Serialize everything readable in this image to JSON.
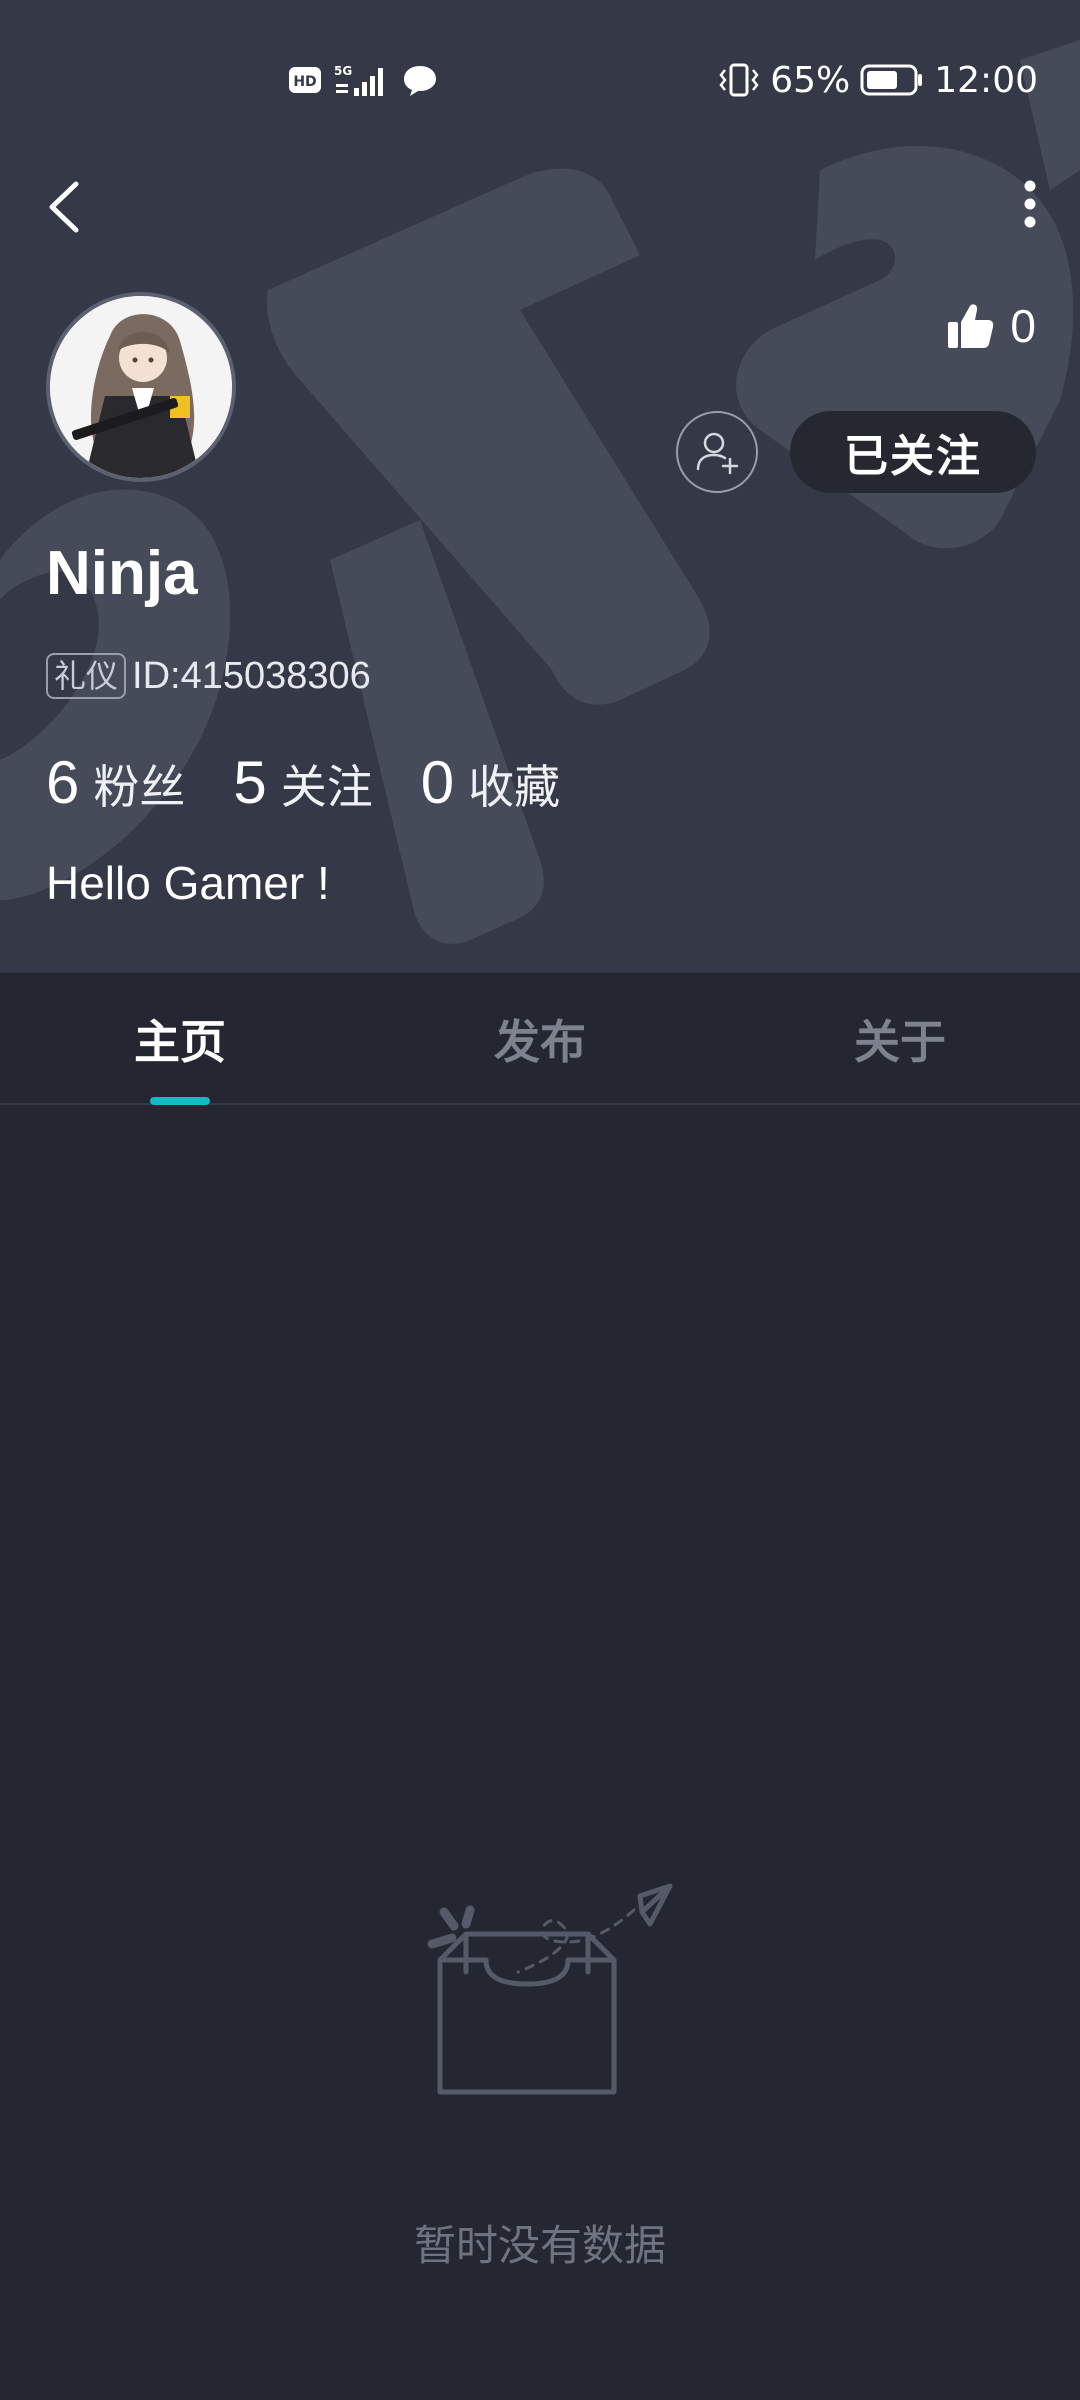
{
  "status_bar": {
    "battery": "65%",
    "time": "12:00",
    "icons": [
      "hd-icon",
      "5g-signal-icon",
      "message-icon",
      "vibrate-icon",
      "battery-icon"
    ]
  },
  "profile": {
    "username": "Ninja",
    "badge": "礼仪",
    "id_text": "ID:415038306",
    "likes": "0",
    "follow_label": "已关注",
    "bio": "Hello Gamer !",
    "stats": [
      {
        "value": "6",
        "label": "粉丝"
      },
      {
        "value": "5",
        "label": "关注"
      },
      {
        "value": "0",
        "label": "收藏"
      }
    ]
  },
  "tabs": [
    {
      "label": "主页",
      "active": true
    },
    {
      "label": "发布",
      "active": false
    },
    {
      "label": "关于",
      "active": false
    }
  ],
  "empty_state": {
    "text": "暂时没有数据"
  },
  "colors": {
    "header_bg": "#343847",
    "page_bg": "#242632",
    "accent": "#19b6c6"
  }
}
